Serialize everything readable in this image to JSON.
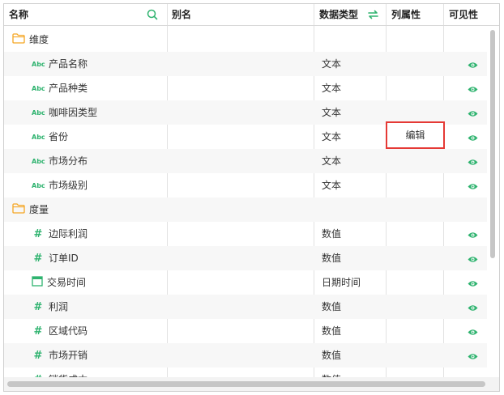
{
  "header": {
    "name": "名称",
    "alias": "别名",
    "datatype": "数据类型",
    "colprop": "列属性",
    "visible": "可见性"
  },
  "colors": {
    "accent": "#2fb36f",
    "highlight": "#e53935",
    "folder": "#f5a623"
  },
  "rows": [
    {
      "kind": "folder",
      "name": "维度"
    },
    {
      "kind": "field",
      "icon": "abc-icon",
      "icon_text": "Abc",
      "name": "产品名称",
      "type": "文本"
    },
    {
      "kind": "field",
      "icon": "abc-icon",
      "icon_text": "Abc",
      "name": "产品种类",
      "type": "文本"
    },
    {
      "kind": "field",
      "icon": "abc-icon",
      "icon_text": "Abc",
      "name": "咖啡因类型",
      "type": "文本"
    },
    {
      "kind": "field",
      "icon": "abc-icon",
      "icon_text": "Abc",
      "name": "省份",
      "type": "文本",
      "action": "编辑"
    },
    {
      "kind": "field",
      "icon": "abc-icon",
      "icon_text": "Abc",
      "name": "市场分布",
      "type": "文本"
    },
    {
      "kind": "field",
      "icon": "abc-icon",
      "icon_text": "Abc",
      "name": "市场级别",
      "type": "文本"
    },
    {
      "kind": "folder",
      "name": "度量"
    },
    {
      "kind": "field",
      "icon": "hash-icon",
      "icon_text": "#",
      "name": "边际利润",
      "type": "数值"
    },
    {
      "kind": "field",
      "icon": "hash-icon",
      "icon_text": "#",
      "name": "订单ID",
      "type": "数值"
    },
    {
      "kind": "field",
      "icon": "calendar-icon",
      "name": "交易时间",
      "type": "日期时间"
    },
    {
      "kind": "field",
      "icon": "hash-icon",
      "icon_text": "#",
      "name": "利润",
      "type": "数值"
    },
    {
      "kind": "field",
      "icon": "hash-icon",
      "icon_text": "#",
      "name": "区域代码",
      "type": "数值"
    },
    {
      "kind": "field",
      "icon": "hash-icon",
      "icon_text": "#",
      "name": "市场开销",
      "type": "数值"
    },
    {
      "kind": "field",
      "icon": "hash-icon",
      "icon_text": "#",
      "name": "销货成本",
      "type": "数值"
    }
  ]
}
